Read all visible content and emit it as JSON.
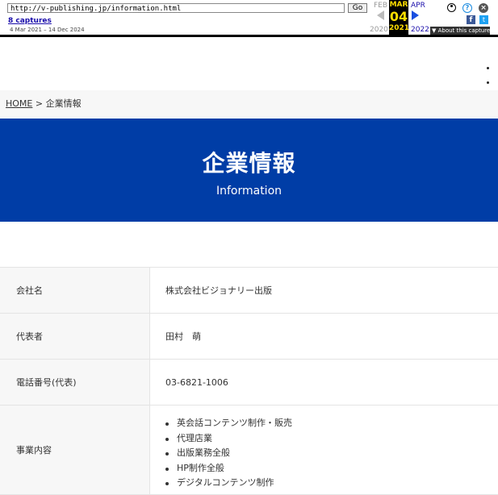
{
  "wayback": {
    "url": "http://v-publishing.jp/information.html",
    "go_label": "Go",
    "captures_label": "8 captures",
    "date_range": "4 Mar 2021 – 14 Dec 2024",
    "prev_month": "FEB",
    "prev_year": "2020",
    "current_month": "MAR",
    "current_day": "04",
    "current_year": "2021",
    "next_month": "APR",
    "next_year": "2022",
    "about_label": "▼ About this capture"
  },
  "breadcrumb": {
    "home": "HOME",
    "separator": ">",
    "current": "企業情報"
  },
  "hero": {
    "title": "企業情報",
    "subtitle": "Information",
    "background_color": "#003da6"
  },
  "company_info": [
    {
      "label": "会社名",
      "value": "株式会社ビジョナリー出版"
    },
    {
      "label": "代表者",
      "value": "田村　萌"
    },
    {
      "label": "電話番号(代表)",
      "value": "03-6821-1006"
    },
    {
      "label": "事業内容",
      "items": [
        "英会話コンテンツ制作・販売",
        "代理店業",
        "出版業務全般",
        "HP制作全般",
        "デジタルコンテンツ制作"
      ]
    }
  ]
}
